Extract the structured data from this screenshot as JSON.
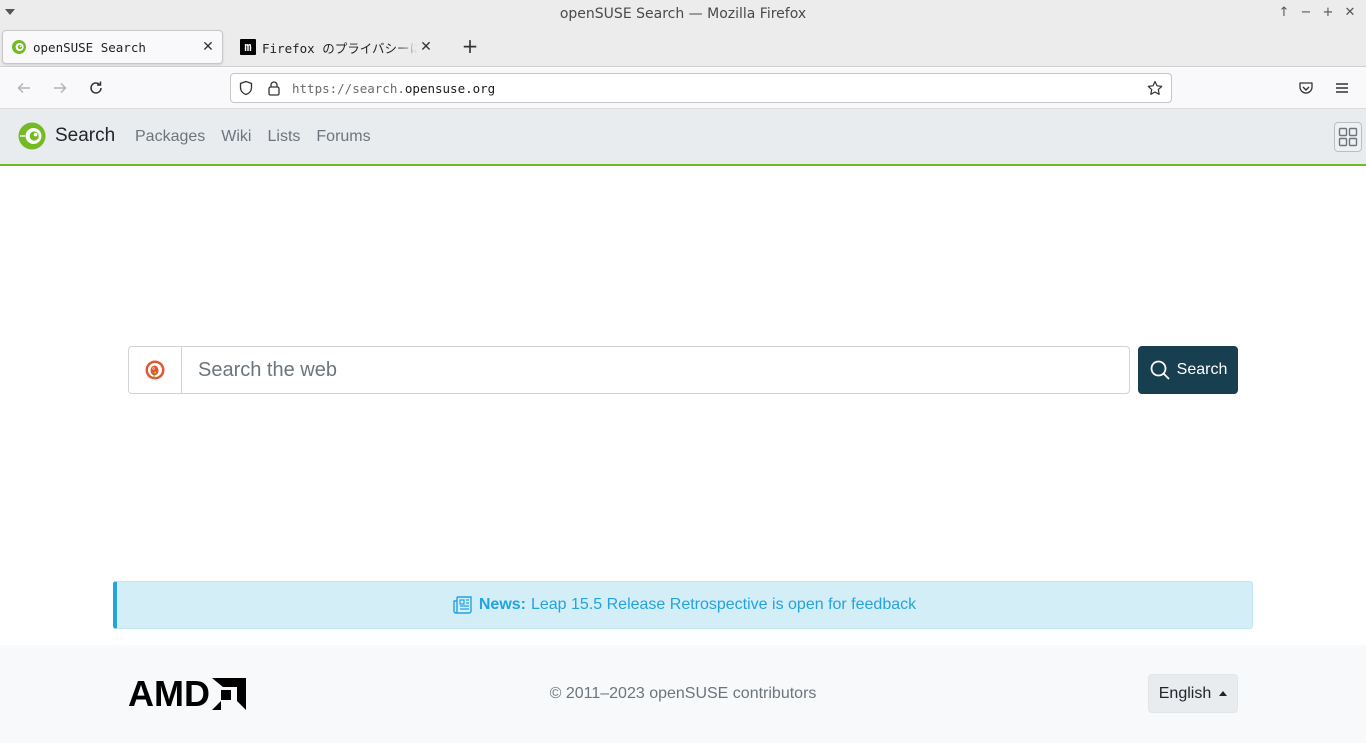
{
  "window": {
    "title": "openSUSE Search — Mozilla Firefox"
  },
  "tabs": [
    {
      "label": "openSUSE Search",
      "active": true
    },
    {
      "label": "Firefox のプライバシーに関",
      "active": false
    }
  ],
  "urlbar": {
    "url_prefix": "https://search.",
    "url_domain": "opensuse.org"
  },
  "site": {
    "brand": "Search",
    "nav": [
      "Packages",
      "Wiki",
      "Lists",
      "Forums"
    ],
    "accent": "#73ba25"
  },
  "search": {
    "placeholder": "Search the web",
    "value": "",
    "button_label": "Search",
    "engine_icon": "duckduckgo-icon"
  },
  "news": {
    "label": "News:",
    "text": "Leap 15.5 Release Retrospective is open for feedback"
  },
  "footer": {
    "sponsor": "AMD",
    "copyright": "© 2011–2023 openSUSE contributors",
    "language": "English"
  }
}
